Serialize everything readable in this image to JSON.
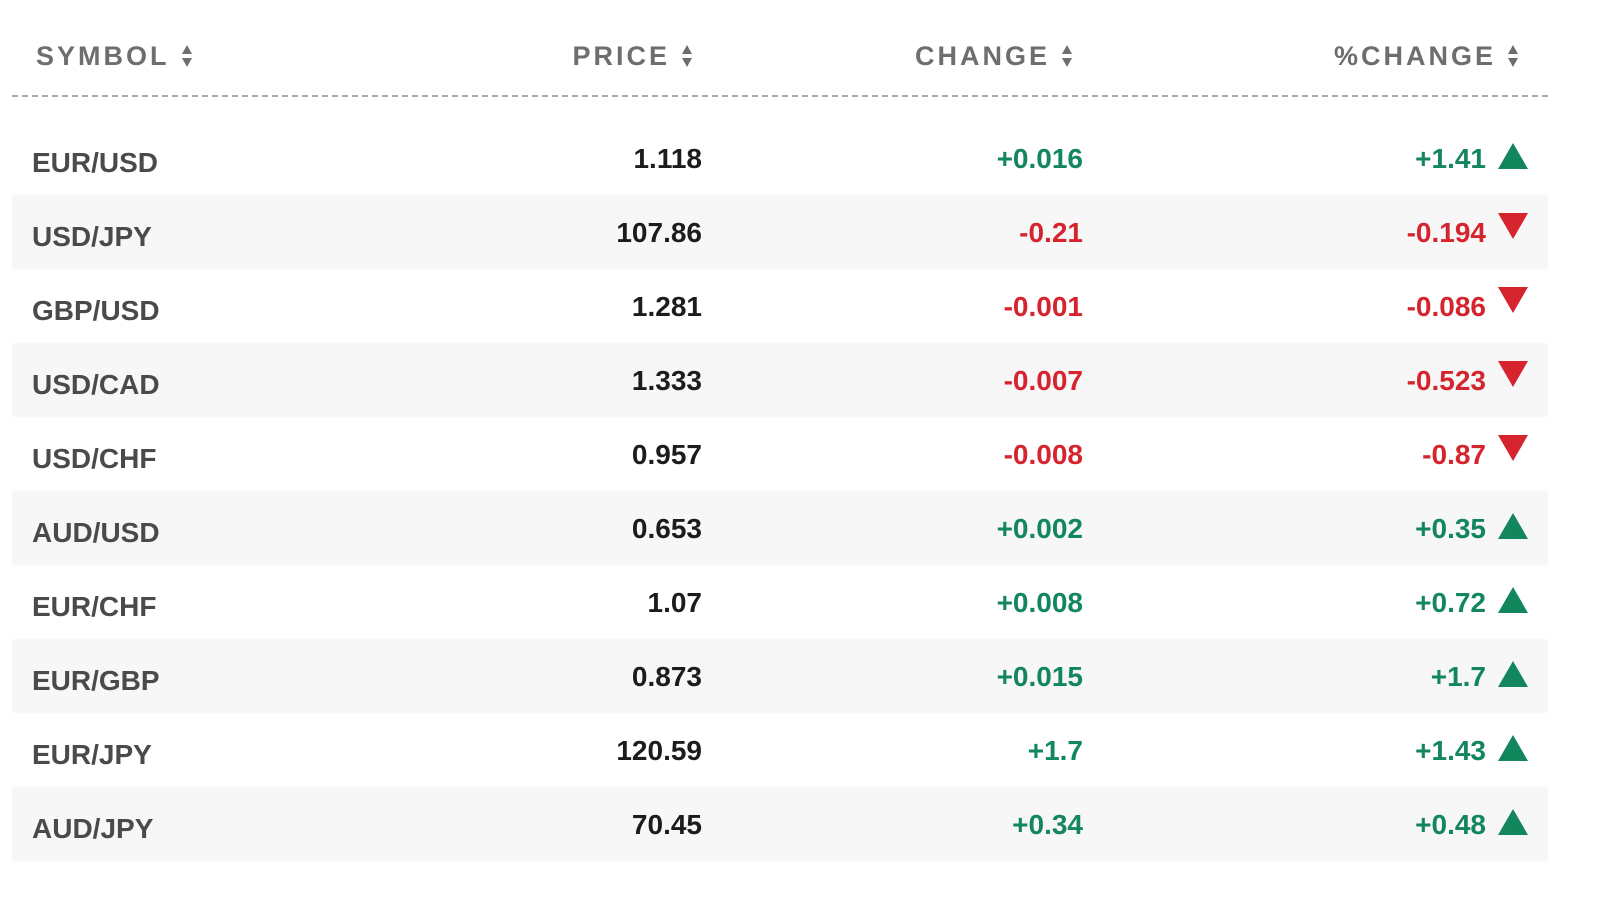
{
  "header": {
    "symbol": "SYMBOL",
    "price": "PRICE",
    "change": "CHANGE",
    "pct_change": "%CHANGE"
  },
  "colors": {
    "positive": "#12865c",
    "negative": "#d6242f",
    "header_text": "#6e6e6e",
    "row_alt_bg": "#f7f7f7"
  },
  "icons": {
    "sort": "sort-updown-icon",
    "up": "triangle-up-icon",
    "down": "triangle-down-icon"
  },
  "rows": [
    {
      "symbol": "EUR/USD",
      "price": "1.118",
      "change": "+0.016",
      "pct_change": "+1.41",
      "direction": "up"
    },
    {
      "symbol": "USD/JPY",
      "price": "107.86",
      "change": "-0.21",
      "pct_change": "-0.194",
      "direction": "down"
    },
    {
      "symbol": "GBP/USD",
      "price": "1.281",
      "change": "-0.001",
      "pct_change": "-0.086",
      "direction": "down"
    },
    {
      "symbol": "USD/CAD",
      "price": "1.333",
      "change": "-0.007",
      "pct_change": "-0.523",
      "direction": "down"
    },
    {
      "symbol": "USD/CHF",
      "price": "0.957",
      "change": "-0.008",
      "pct_change": "-0.87",
      "direction": "down"
    },
    {
      "symbol": "AUD/USD",
      "price": "0.653",
      "change": "+0.002",
      "pct_change": "+0.35",
      "direction": "up"
    },
    {
      "symbol": "EUR/CHF",
      "price": "1.07",
      "change": "+0.008",
      "pct_change": "+0.72",
      "direction": "up"
    },
    {
      "symbol": "EUR/GBP",
      "price": "0.873",
      "change": "+0.015",
      "pct_change": "+1.7",
      "direction": "up"
    },
    {
      "symbol": "EUR/JPY",
      "price": "120.59",
      "change": "+1.7",
      "pct_change": "+1.43",
      "direction": "up"
    },
    {
      "symbol": "AUD/JPY",
      "price": "70.45",
      "change": "+0.34",
      "pct_change": "+0.48",
      "direction": "up"
    }
  ]
}
